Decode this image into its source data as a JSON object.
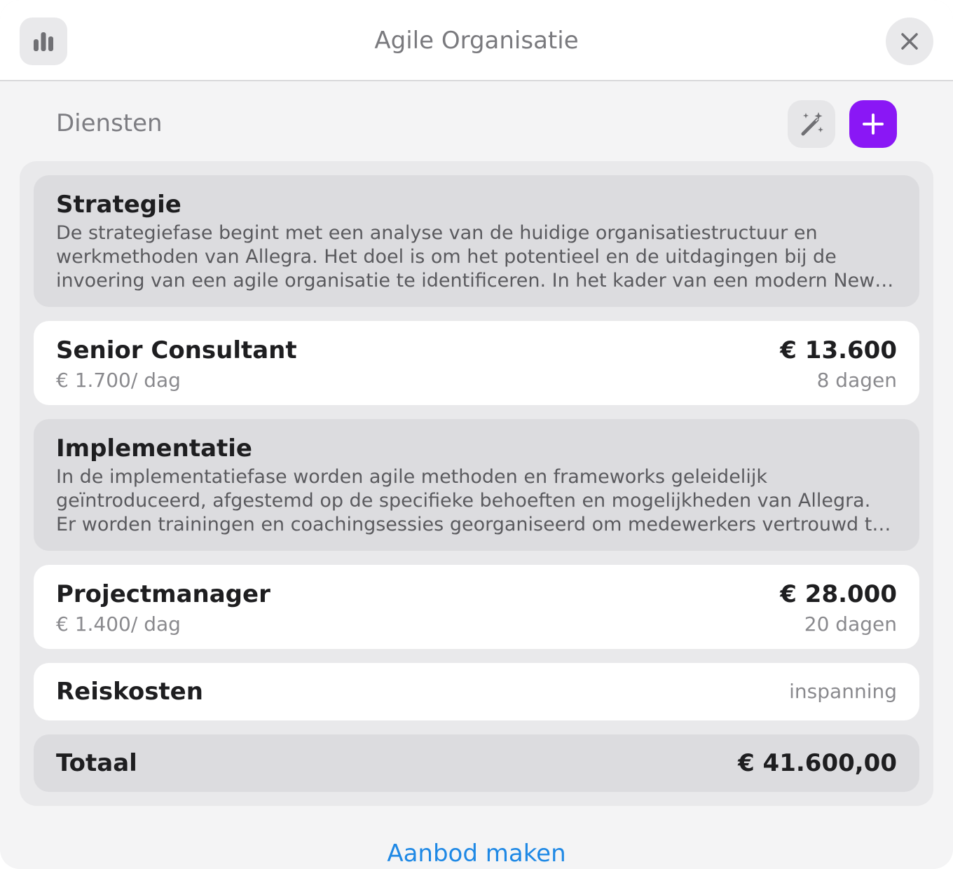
{
  "header": {
    "title": "Agile Organisatie"
  },
  "section": {
    "title": "Diensten"
  },
  "phases": [
    {
      "title": "Strategie",
      "description_lines": [
        "De strategiefase begint met een analyse van de huidige organisatiestructuur en",
        "werkmethoden van Allegra. Het doel is om het potentieel en de uitdagingen bij de",
        "invoering van een agile organisatie te identificeren. In het kader van een modern New …"
      ]
    },
    {
      "title": "Implementatie",
      "description_lines": [
        "In de implementatiefase worden agile methoden en frameworks geleidelijk",
        "geïntroduceerd, afgestemd op de specifieke behoeften en mogelijkheden van Allegra.",
        "Er worden trainingen en coachingsessies georganiseerd om medewerkers vertrouwd t…"
      ]
    }
  ],
  "roles": [
    {
      "title": "Senior Consultant",
      "rate": "€ 1.700/ dag",
      "amount": "€ 13.600",
      "days": "8 dagen"
    },
    {
      "title": "Projectmanager",
      "rate": "€ 1.400/ dag",
      "amount": "€ 28.000",
      "days": "20 dagen"
    }
  ],
  "expense": {
    "title": "Reiskosten",
    "type": "inspanning"
  },
  "total": {
    "label": "Totaal",
    "amount": "€ 41.600,00"
  },
  "footer": {
    "link": "Aanbod maken"
  },
  "icons": {
    "chart": "bar-chart-icon",
    "close": "close-icon",
    "magic": "magic-wand-icon",
    "add": "plus-icon"
  },
  "colors": {
    "accent": "#8a17f5",
    "link": "#1e88e5"
  }
}
